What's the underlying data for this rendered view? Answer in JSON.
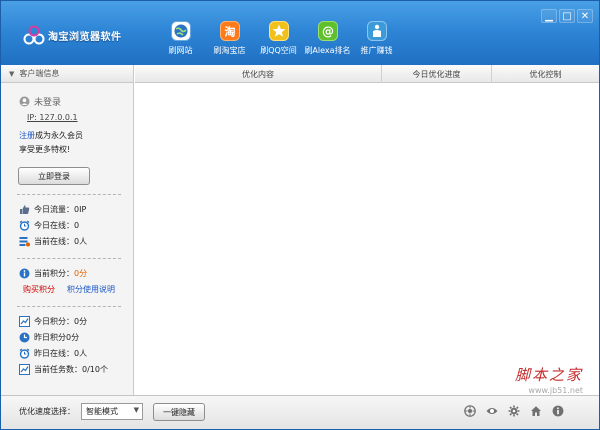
{
  "app": {
    "title": "淘宝浏览器软件"
  },
  "nav": {
    "items": [
      {
        "label": "刷网站",
        "icon": "globe-icon"
      },
      {
        "label": "刷淘宝店",
        "icon": "taobao-icon"
      },
      {
        "label": "刷QQ空间",
        "icon": "star-icon"
      },
      {
        "label": "刷Alexa排名",
        "icon": "at-sign-icon"
      },
      {
        "label": "推广赚钱",
        "icon": "promote-icon"
      }
    ]
  },
  "window_controls": {
    "minimize": "▁",
    "maximize": "□",
    "close": "✕"
  },
  "sidebar": {
    "header": "客户端信息",
    "user": {
      "status": "未登录",
      "ip": "IP: 127.0.0.1",
      "register_link": "注册",
      "register_text": "成为永久会员",
      "privilege_text": "享受更多特权!"
    },
    "login_button": "立即登录",
    "today": {
      "traffic": "今日流量：0IP",
      "online": "今日在线：0",
      "current_online": "当前在线：0人"
    },
    "points": {
      "label": "当前积分：",
      "value": "0分",
      "buy_link": "购买积分",
      "help_link": "积分使用说明"
    },
    "yesterday": {
      "today_points": "今日积分：0分",
      "yesterday_points": "昨日积分0分",
      "yesterday_online": "昨日在线：0人",
      "tasks": "当前任务数：0/10个"
    }
  },
  "grid": {
    "columns": [
      "优化内容",
      "今日优化进度",
      "优化控制"
    ]
  },
  "bottom": {
    "speed_label": "优化速度选择：",
    "speed_value": "智能模式",
    "hide_button": "一键隐藏"
  },
  "watermark": {
    "title": "脚本之家",
    "url": "www.jb51.net"
  },
  "colors": {
    "title_bar": "#2f86d6",
    "link_blue": "#1a56c6",
    "link_red": "#d10000",
    "points_orange": "#e06000"
  }
}
